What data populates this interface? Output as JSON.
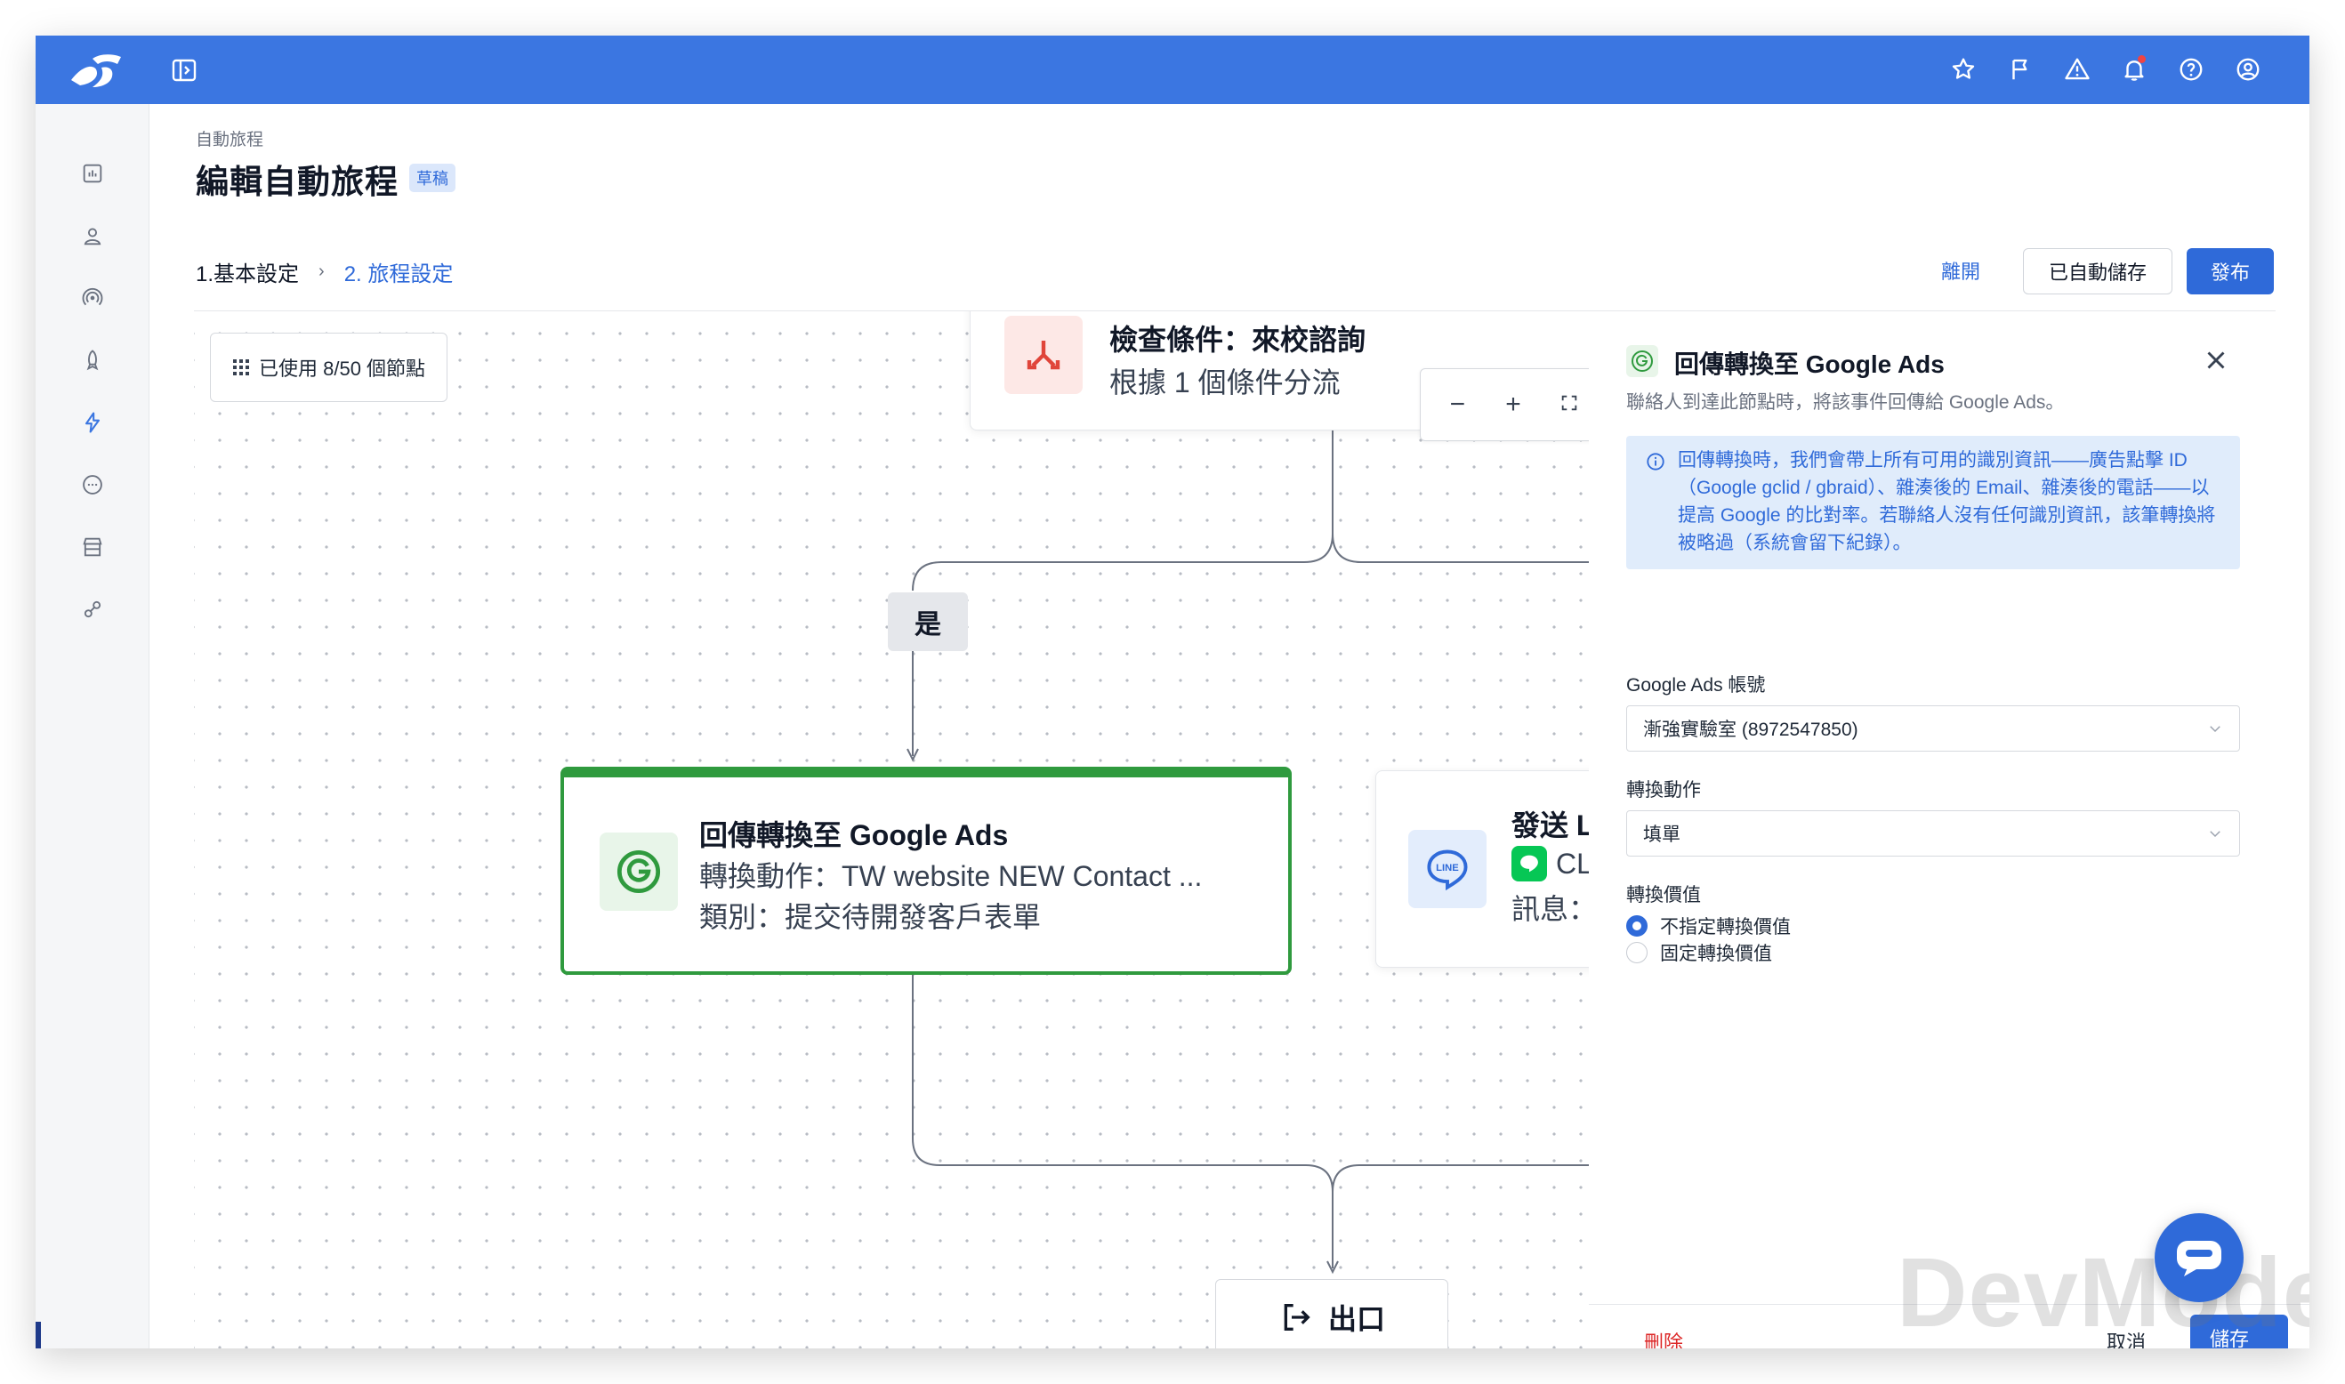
{
  "breadcrumb": "自動旅程",
  "page_title": "編輯自動旅程",
  "status_badge": "草稿",
  "steps": {
    "step1": "1.基本設定",
    "separator": "›",
    "step2": "2. 旅程設定"
  },
  "actions": {
    "leave": "離開",
    "autosaved": "已自動儲存",
    "publish": "發布"
  },
  "canvas": {
    "node_usage": "已使用 8/50 個節點",
    "condition_node": {
      "title": "檢查條件：來校諮詢",
      "subtitle": "根據 1 個條件分流"
    },
    "zoom": {
      "out": "−",
      "in": "+"
    },
    "branch_yes": "是",
    "google_ads_node": {
      "title": "回傳轉換至 Google Ads",
      "action": "轉換動作：TW website NEW Contact ...",
      "category": "類別：提交待開發客戶表單"
    },
    "line_node": {
      "title": "發送 LIN",
      "line2": "CL E",
      "line3": "訊息：TI",
      "badge_text": "LINE"
    },
    "exit_node": "出口"
  },
  "panel": {
    "title": "回傳轉換至 Google Ads",
    "description": "聯絡人到達此節點時，將該事件回傳給 Google Ads。",
    "info": "回傳轉換時，我們會帶上所有可用的識別資訊——廣告點擊 ID（Google gclid / gbraid）、雜湊後的 Email、雜湊後的電話——以提高 Google 的比對率。若聯絡人沒有任何識別資訊，該筆轉換將被略過（系統會留下紀錄）。",
    "account_label": "Google Ads 帳號",
    "account_value": "漸強實驗室 (8972547850)",
    "action_label": "轉換動作",
    "action_value": "填單",
    "value_label": "轉換價值",
    "radio_unspecified": "不指定轉換價值",
    "radio_fixed": "固定轉換價值",
    "delete": "刪除",
    "cancel": "取消",
    "save": "儲存"
  },
  "watermark": "DevMode",
  "colors": {
    "topbar": "#3b76e1",
    "primary": "#2f6ad9",
    "success_border": "#2f9a3e",
    "danger": "#dc2626"
  }
}
